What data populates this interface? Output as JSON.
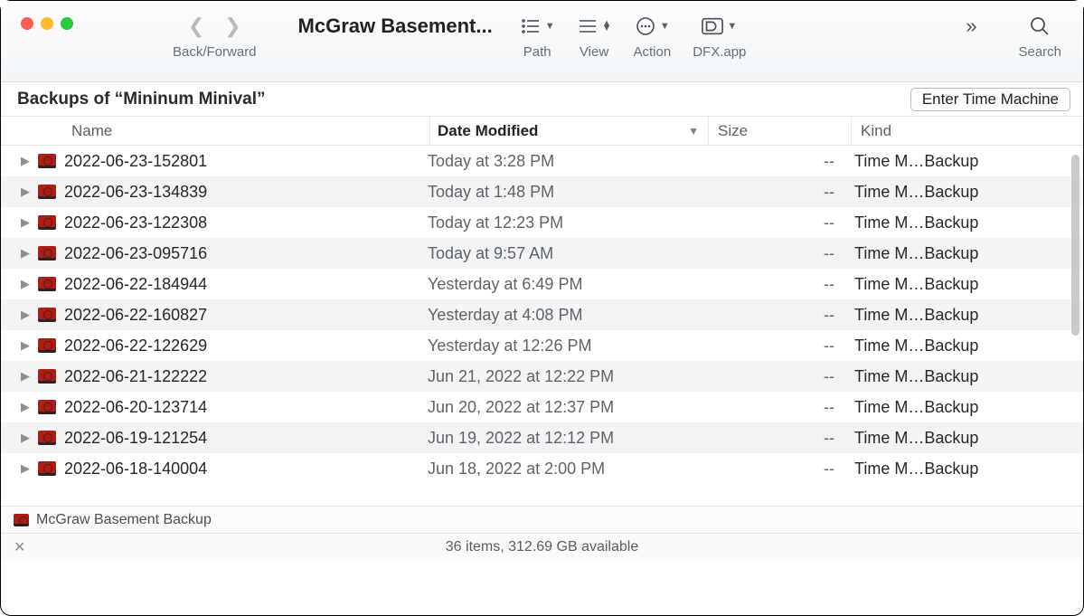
{
  "window_title": "McGraw Basement...",
  "toolbar": {
    "back_forward_label": "Back/Forward",
    "path_label": "Path",
    "view_label": "View",
    "action_label": "Action",
    "dfx_label": "DFX.app",
    "search_label": "Search"
  },
  "subheader": {
    "title": "Backups of “Mininum Minival”",
    "time_machine_button": "Enter Time Machine"
  },
  "columns": {
    "name": "Name",
    "date": "Date Modified",
    "size": "Size",
    "kind": "Kind"
  },
  "rows": [
    {
      "name": "2022-06-23-152801",
      "date": "Today at 3:28 PM",
      "size": "--",
      "kind": "Time M…Backup"
    },
    {
      "name": "2022-06-23-134839",
      "date": "Today at 1:48 PM",
      "size": "--",
      "kind": "Time M…Backup"
    },
    {
      "name": "2022-06-23-122308",
      "date": "Today at 12:23 PM",
      "size": "--",
      "kind": "Time M…Backup"
    },
    {
      "name": "2022-06-23-095716",
      "date": "Today at 9:57 AM",
      "size": "--",
      "kind": "Time M…Backup"
    },
    {
      "name": "2022-06-22-184944",
      "date": "Yesterday at 6:49 PM",
      "size": "--",
      "kind": "Time M…Backup"
    },
    {
      "name": "2022-06-22-160827",
      "date": "Yesterday at 4:08 PM",
      "size": "--",
      "kind": "Time M…Backup"
    },
    {
      "name": "2022-06-22-122629",
      "date": "Yesterday at 12:26 PM",
      "size": "--",
      "kind": "Time M…Backup"
    },
    {
      "name": "2022-06-21-122222",
      "date": "Jun 21, 2022 at 12:22 PM",
      "size": "--",
      "kind": "Time M…Backup"
    },
    {
      "name": "2022-06-20-123714",
      "date": "Jun 20, 2022 at 12:37 PM",
      "size": "--",
      "kind": "Time M…Backup"
    },
    {
      "name": "2022-06-19-121254",
      "date": "Jun 19, 2022 at 12:12 PM",
      "size": "--",
      "kind": "Time M…Backup"
    },
    {
      "name": "2022-06-18-140004",
      "date": "Jun 18, 2022 at 2:00 PM",
      "size": "--",
      "kind": "Time M…Backup"
    }
  ],
  "path_bar": "McGraw Basement Backup",
  "status_bar": "36 items, 312.69 GB available"
}
